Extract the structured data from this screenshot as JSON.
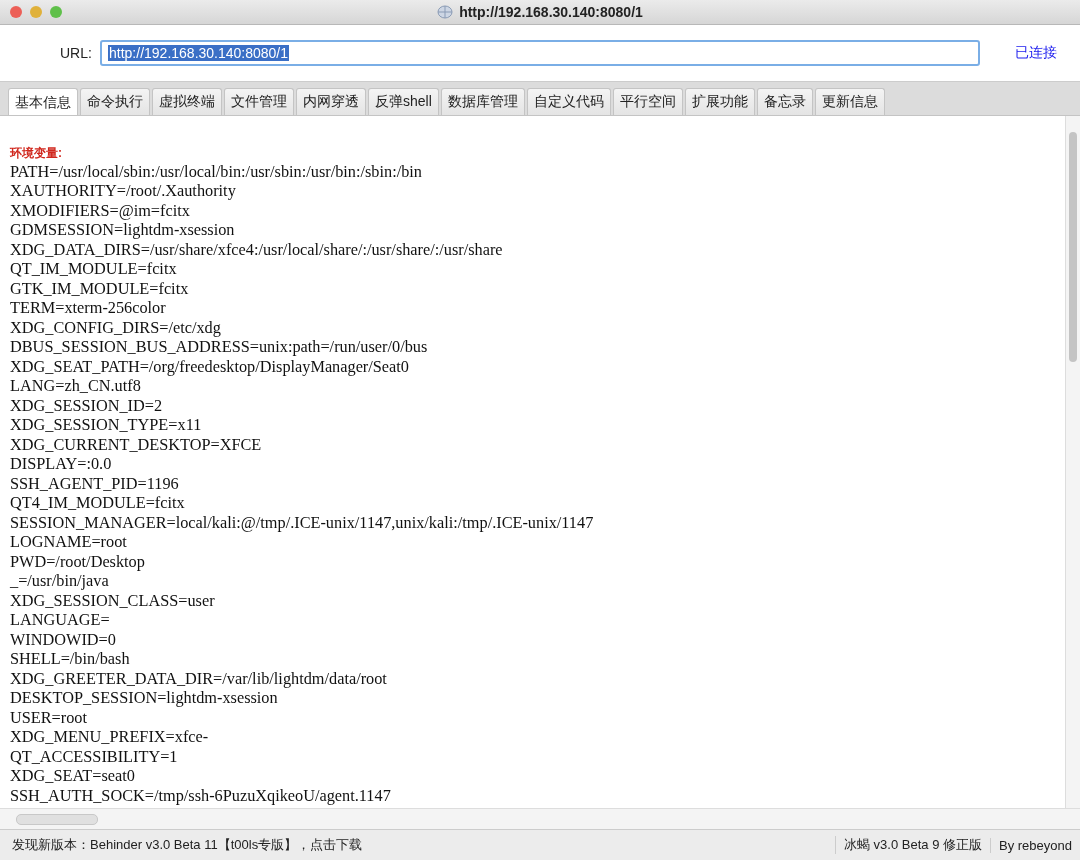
{
  "window": {
    "title": "http://192.168.30.140:8080/1"
  },
  "url_bar": {
    "label": "URL:",
    "value": "http://192.168.30.140:8080/1",
    "status": "已连接"
  },
  "tabs": [
    {
      "label": "基本信息",
      "selected": true
    },
    {
      "label": "命令执行",
      "selected": false
    },
    {
      "label": "虚拟终端",
      "selected": false
    },
    {
      "label": "文件管理",
      "selected": false
    },
    {
      "label": "内网穿透",
      "selected": false
    },
    {
      "label": "反弹shell",
      "selected": false
    },
    {
      "label": "数据库管理",
      "selected": false
    },
    {
      "label": "自定义代码",
      "selected": false
    },
    {
      "label": "平行空间",
      "selected": false
    },
    {
      "label": "扩展功能",
      "selected": false
    },
    {
      "label": "备忘录",
      "selected": false
    },
    {
      "label": "更新信息",
      "selected": false
    }
  ],
  "content": {
    "heading": "环境变量:",
    "lines": [
      "PATH=/usr/local/sbin:/usr/local/bin:/usr/sbin:/usr/bin:/sbin:/bin",
      "XAUTHORITY=/root/.Xauthority",
      "XMODIFIERS=@im=fcitx",
      "GDMSESSION=lightdm-xsession",
      "XDG_DATA_DIRS=/usr/share/xfce4:/usr/local/share/:/usr/share/:/usr/share",
      "QT_IM_MODULE=fcitx",
      "GTK_IM_MODULE=fcitx",
      "TERM=xterm-256color",
      "XDG_CONFIG_DIRS=/etc/xdg",
      "DBUS_SESSION_BUS_ADDRESS=unix:path=/run/user/0/bus",
      "XDG_SEAT_PATH=/org/freedesktop/DisplayManager/Seat0",
      "LANG=zh_CN.utf8",
      "XDG_SESSION_ID=2",
      "XDG_SESSION_TYPE=x11",
      "XDG_CURRENT_DESKTOP=XFCE",
      "DISPLAY=:0.0",
      "SSH_AGENT_PID=1196",
      "QT4_IM_MODULE=fcitx",
      "SESSION_MANAGER=local/kali:@/tmp/.ICE-unix/1147,unix/kali:/tmp/.ICE-unix/1147",
      "LOGNAME=root",
      "PWD=/root/Desktop",
      "_=/usr/bin/java",
      "XDG_SESSION_CLASS=user",
      "LANGUAGE=",
      "WINDOWID=0",
      "SHELL=/bin/bash",
      "XDG_GREETER_DATA_DIR=/var/lib/lightdm/data/root",
      "DESKTOP_SESSION=lightdm-xsession",
      "USER=root",
      "XDG_MENU_PREFIX=xfce-",
      "QT_ACCESSIBILITY=1",
      "XDG_SEAT=seat0",
      "SSH_AUTH_SOCK=/tmp/ssh-6PuzuXqikeoU/agent.1147"
    ]
  },
  "status_bar": {
    "message": "发现新版本：Behinder v3.0 Beta 11【t00ls专版】，点击下载",
    "version": "冰蝎 v3.0 Beta 9 修正版",
    "author": "By rebeyond"
  }
}
